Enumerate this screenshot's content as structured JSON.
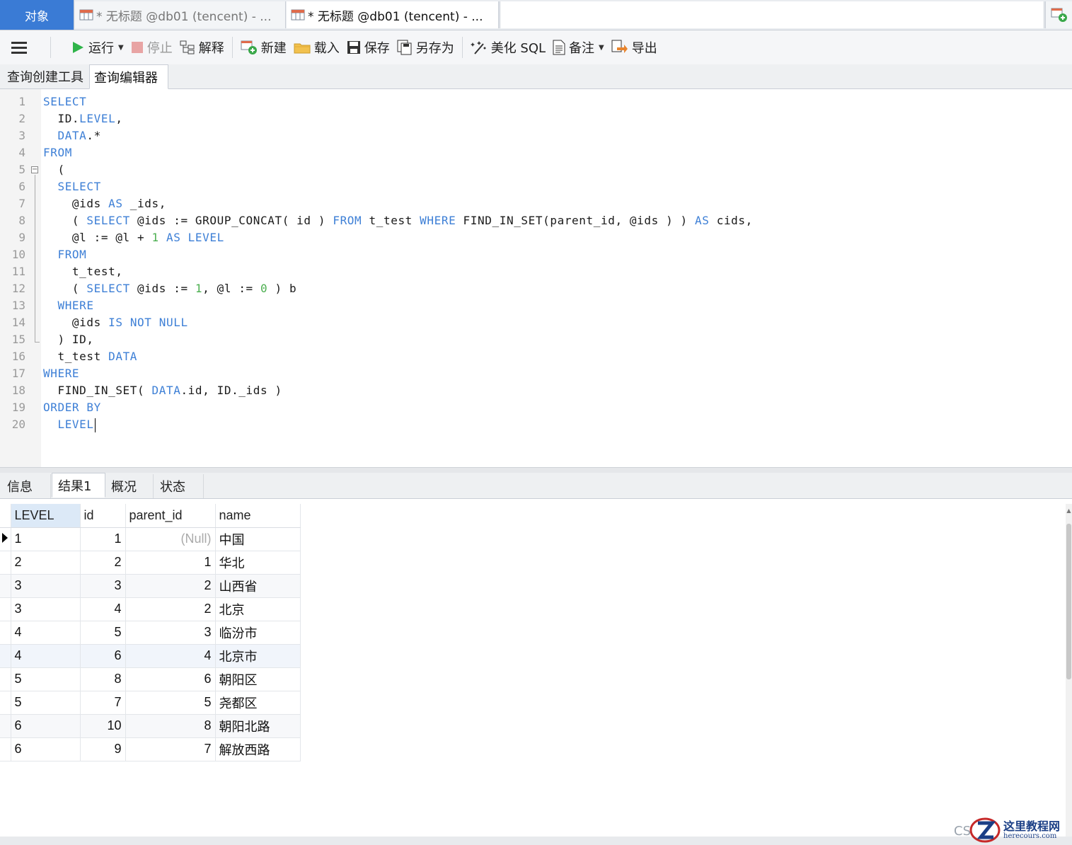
{
  "tabs": {
    "objects": "对象",
    "query1": "* 无标题 @db01 (tencent) - ...",
    "query2": "* 无标题 @db01 (tencent) - ..."
  },
  "toolbar": {
    "run": "运行",
    "stop": "停止",
    "explain": "解释",
    "new": "新建",
    "load": "载入",
    "save": "保存",
    "save_as": "另存为",
    "beautify": "美化 SQL",
    "comment": "备注",
    "export": "导出"
  },
  "subtabs": {
    "builder": "查询创建工具",
    "editor": "查询编辑器"
  },
  "editor": {
    "line_numbers": [
      "1",
      "2",
      "3",
      "4",
      "5",
      "6",
      "7",
      "8",
      "9",
      "10",
      "11",
      "12",
      "13",
      "14",
      "15",
      "16",
      "17",
      "18",
      "19",
      "20"
    ]
  },
  "result_tabs": {
    "info": "信息",
    "result1": "结果1",
    "overview": "概况",
    "status": "状态"
  },
  "grid": {
    "columns": [
      "LEVEL",
      "id",
      "parent_id",
      "name"
    ],
    "rows": [
      [
        "1",
        "1",
        "(Null)",
        "中国"
      ],
      [
        "2",
        "2",
        "1",
        "华北"
      ],
      [
        "3",
        "3",
        "2",
        "山西省"
      ],
      [
        "3",
        "4",
        "2",
        "北京"
      ],
      [
        "4",
        "5",
        "3",
        "临汾市"
      ],
      [
        "4",
        "6",
        "4",
        "北京市"
      ],
      [
        "5",
        "8",
        "6",
        "朝阳区"
      ],
      [
        "5",
        "7",
        "5",
        "尧都区"
      ],
      [
        "6",
        "10",
        "8",
        "朝阳北路"
      ],
      [
        "6",
        "9",
        "7",
        "解放西路"
      ]
    ]
  },
  "watermark": {
    "cs": "CS",
    "title": "这里教程网",
    "site": "herecours.com"
  },
  "colors": {
    "accent": "#3a7bd5",
    "keyword": "#3d7fd6",
    "number": "#4caf50",
    "selected_header": "#dce9f7"
  }
}
